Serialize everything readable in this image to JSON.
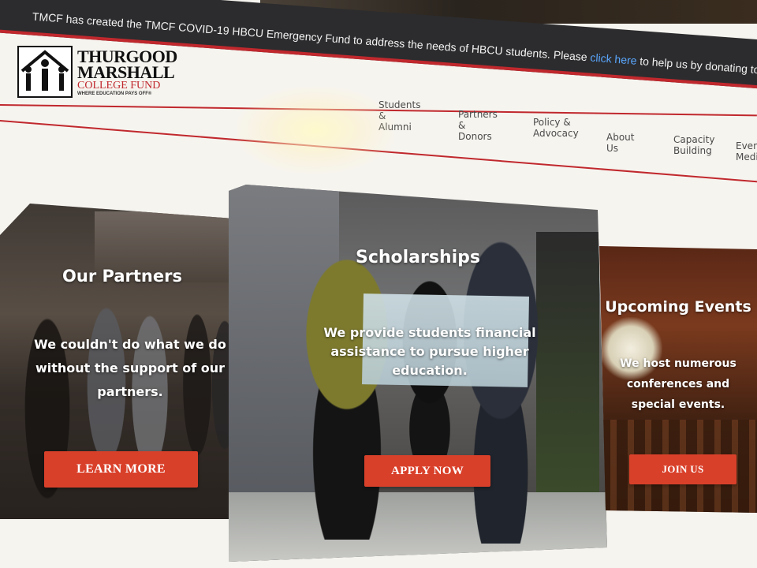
{
  "banner": {
    "text": "TMCF has created the TMCF COVID-19 HBCU Emergency Fund to address the needs of HBCU students. Please ",
    "link_text": "click here",
    "text_after": " to help us by donating tod"
  },
  "logo": {
    "line1": "THURGOOD",
    "line2": "MARSHALL",
    "line3": "COLLEGE FUND",
    "tagline": "WHERE EDUCATION PAYS OFF®"
  },
  "nav": {
    "items": [
      {
        "line1": "Students",
        "line2": "& Alumni"
      },
      {
        "line1": "Partners",
        "line2": "& Donors"
      },
      {
        "line1": "Policy &",
        "line2": "Advocacy"
      },
      {
        "line1": "About Us",
        "line2": ""
      },
      {
        "line1": "Capacity",
        "line2": "Building"
      },
      {
        "line1": "Event",
        "line2": "Media"
      }
    ]
  },
  "cards": [
    {
      "title": "Our Partners",
      "description": "We couldn't do what we do without the support of our partners.",
      "button": "LEARN MORE"
    },
    {
      "title": "Scholarships",
      "description": "We provide students financial assistance to pursue higher education.",
      "button": "APPLY NOW"
    },
    {
      "title": "Upcoming Events",
      "description": "We host numerous conferences and special events.",
      "button": "JOIN US"
    }
  ],
  "colors": {
    "accent_red": "#c0282d",
    "button_red": "#d9402a",
    "banner_bg": "#2c2c2e",
    "link_blue": "#5aa7ff"
  }
}
